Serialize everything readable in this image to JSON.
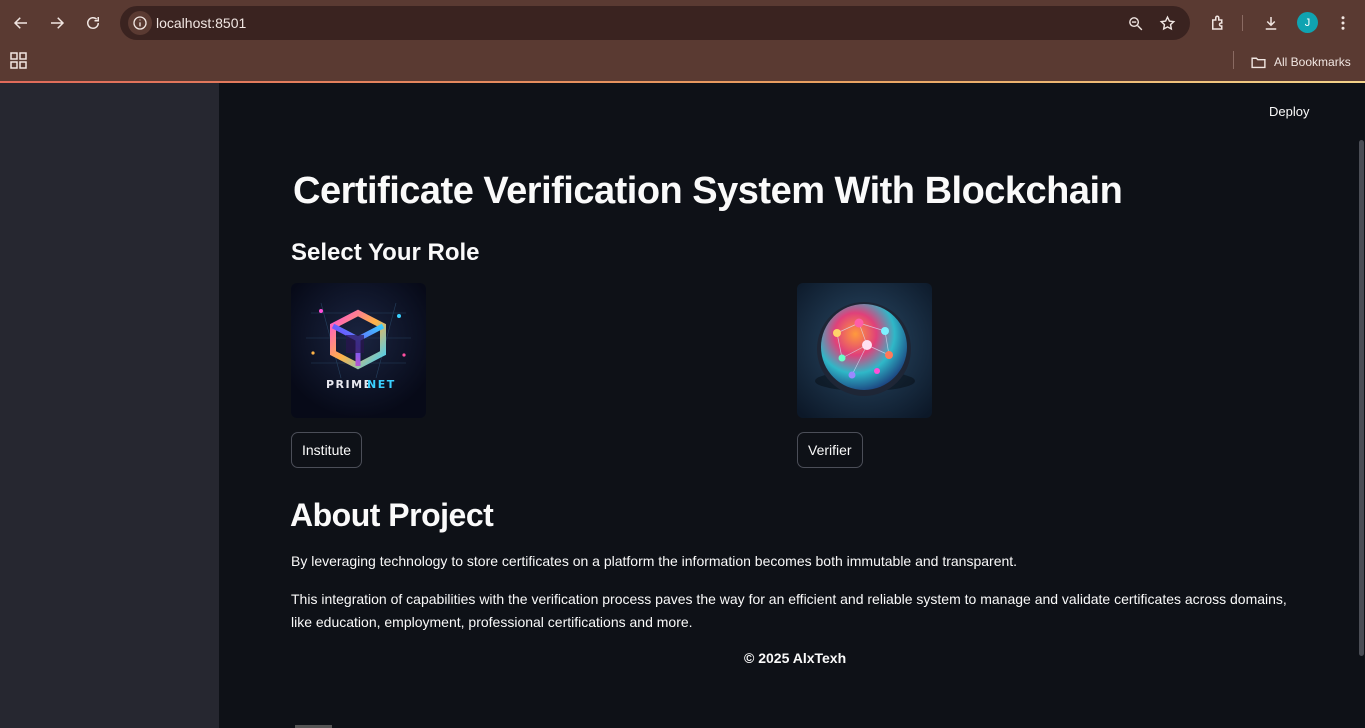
{
  "browser": {
    "url": "localhost:8501",
    "profile_initial": "J",
    "bookmarks_label": "All Bookmarks"
  },
  "app": {
    "deploy_label": "Deploy",
    "title": "Certificate Verification System With Blockchain",
    "role_heading": "Select Your Role",
    "roles": [
      {
        "label": "Institute",
        "logo_text_a": "PRIME",
        "logo_text_b": "NET"
      },
      {
        "label": "Verifier"
      }
    ],
    "about_heading": "About Project",
    "paragraphs": [
      "By leveraging technology to store certificates on a platform the information becomes both immutable and transparent.",
      "This integration of capabilities with the verification process paves the way for an efficient and reliable system to manage and validate certificates across domains, like education, employment, professional certifications and more."
    ],
    "footer": "© 2025 AlxTexh"
  },
  "colors": {
    "chrome": "#5a3a32",
    "omnibox": "#3a2320",
    "sidebar": "#262730",
    "background": "#0e1117",
    "avatar": "#0fa3b1"
  }
}
